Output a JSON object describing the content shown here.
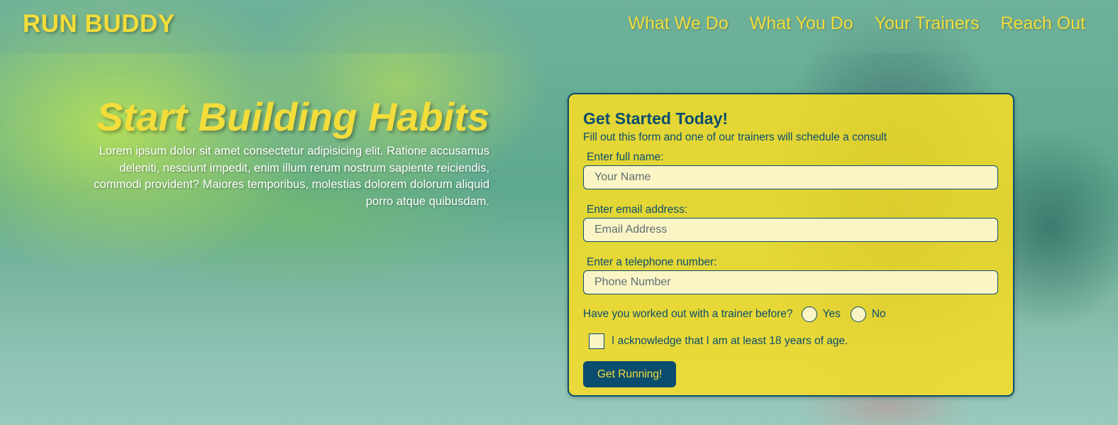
{
  "header": {
    "brand": "RUN BUDDY",
    "nav": [
      {
        "label": "What We Do"
      },
      {
        "label": "What You Do"
      },
      {
        "label": "Your Trainers"
      },
      {
        "label": "Reach Out"
      }
    ]
  },
  "hero": {
    "title": "Start Building Habits",
    "body": "Lorem ipsum dolor sit amet consectetur adipisicing elit. Ratione accusamus deleniti, nesciunt impedit, enim illum rerum nostrum sapiente reiciendis, commodi provident? Maiores temporibus, molestias dolorem dolorum aliquid porro atque quibusdam."
  },
  "form": {
    "title": "Get Started Today!",
    "subtitle": "Fill out this form and one of our trainers will schedule a consult",
    "name": {
      "label": "Enter full name:",
      "placeholder": "Your Name",
      "value": ""
    },
    "email": {
      "label": "Enter email address:",
      "placeholder": "Email Address",
      "value": ""
    },
    "phone": {
      "label": "Enter a telephone number:",
      "placeholder": "Phone Number",
      "value": ""
    },
    "trainer_question": "Have you worked out with a trainer before?",
    "yes_label": "Yes",
    "no_label": "No",
    "age_ack": "I acknowledge that I am at least 18 years of age.",
    "submit_label": "Get Running!"
  },
  "colors": {
    "accent": "#f3dd3a",
    "primary": "#0b4d6e"
  }
}
